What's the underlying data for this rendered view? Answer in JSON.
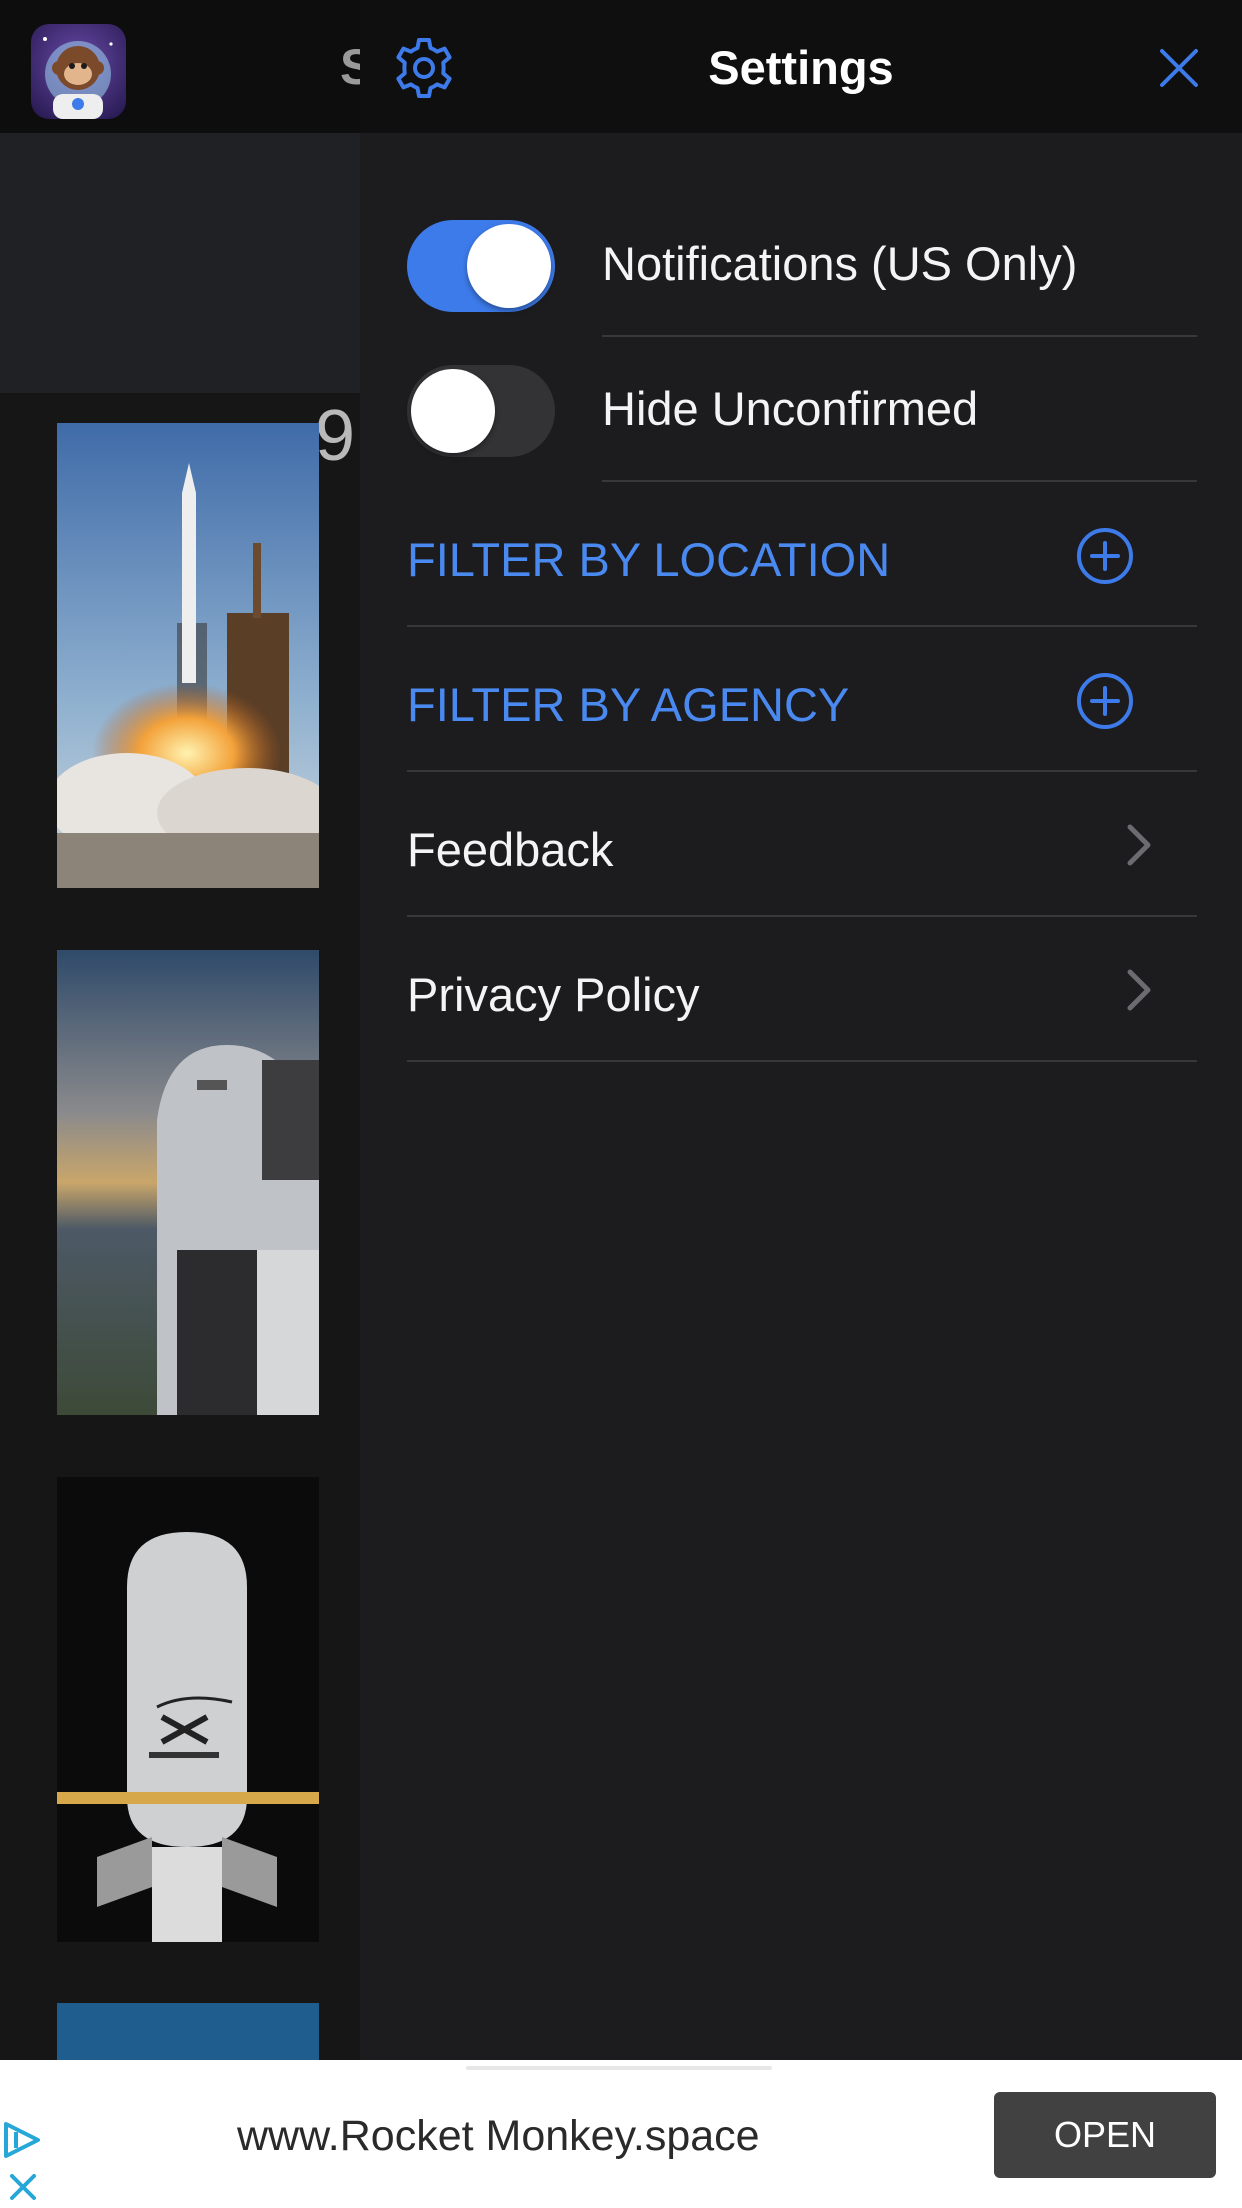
{
  "background": {
    "title_fragment": "S",
    "countdown_fragment": "9"
  },
  "drawer": {
    "title": "Settings",
    "toggles": [
      {
        "label": "Notifications (US Only)",
        "on": true
      },
      {
        "label": "Hide Unconfirmed",
        "on": false
      }
    ],
    "filters": [
      {
        "label": "FILTER BY LOCATION"
      },
      {
        "label": "FILTER BY AGENCY"
      }
    ],
    "links": [
      {
        "label": "Feedback"
      },
      {
        "label": "Privacy Policy"
      }
    ]
  },
  "ad": {
    "text": "www.Rocket Monkey.space",
    "button_label": "OPEN"
  },
  "colors": {
    "accent": "#3d7bea",
    "link_blue": "#4a8af0",
    "drawer_bg": "#1c1c1e",
    "header_bg": "#0f0f10"
  },
  "icons": {
    "settings": "gear-icon",
    "close": "close-icon",
    "add": "plus-circle-icon",
    "disclosure": "chevron-right-icon",
    "ad_choices": "adchoices-icon"
  }
}
